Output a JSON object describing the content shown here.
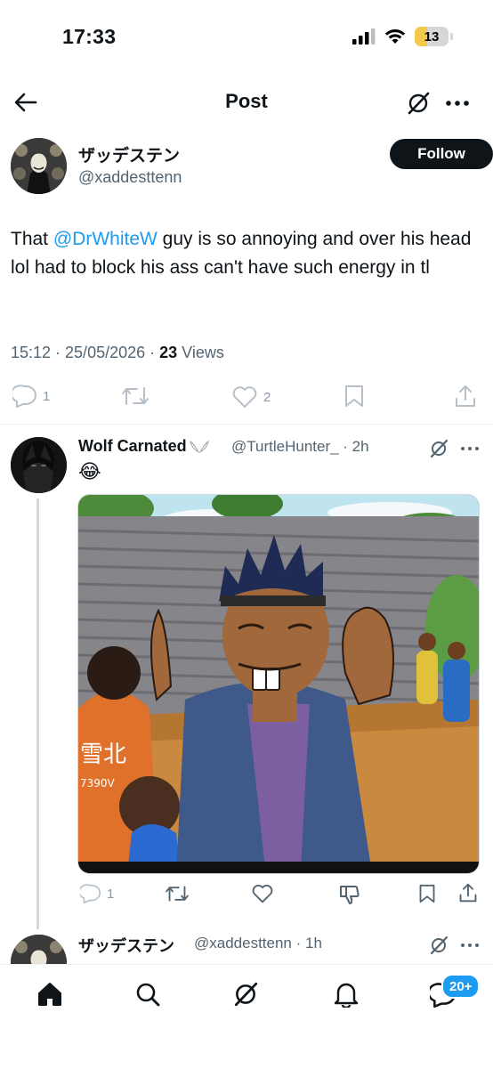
{
  "status_bar": {
    "time": "17:33",
    "battery": "13"
  },
  "header": {
    "title": "Post"
  },
  "post": {
    "display_name": "ザッデステン",
    "handle": "@xaddesttenn",
    "follow_label": "Follow",
    "text_before": "That ",
    "mention": "@DrWhiteW",
    "text_after": " guy is so annoying and over his head lol had to block his ass can't have such energy in tl",
    "timestamp": "15:12 · 25/05/2026 · ",
    "views_count": "23",
    "views_label": " Views",
    "replies": "1",
    "likes": "2"
  },
  "reply": {
    "display_name": "Wolf Carnated",
    "handle_time": "@TurtleHunter_ · 2h",
    "emoji": "😂",
    "image_text_1": "雪北",
    "image_text_2": "7390V",
    "replies": "1"
  },
  "reply2": {
    "display_name": "ザッデステン",
    "handle_time": "@xaddesttenn · 1h"
  },
  "bottom_nav": {
    "notifications_badge": "20+"
  },
  "colors": {
    "accent": "#1d9bf0",
    "text": "#0f1419",
    "muted": "#536471"
  }
}
